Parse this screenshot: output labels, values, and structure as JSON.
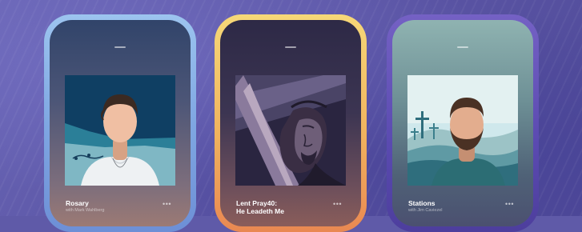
{
  "cards": [
    {
      "title": "Rosary",
      "subtitle": "with Mark Wahlberg",
      "more_label": "•••",
      "artwork": "man-portrait-artwork"
    },
    {
      "title_line1": "Lent Pray40:",
      "title_line2": "He Leadeth Me",
      "more_label": "•••",
      "artwork": "jesus-with-cross-artwork"
    },
    {
      "title": "Stations",
      "subtitle": "with Jim Caviezel",
      "more_label": "•••",
      "artwork": "bearded-man-crosses-artwork"
    }
  ],
  "colors": {
    "background": "#5f5aa8",
    "frame_blue": "#8fb6ea",
    "frame_gold": "#f0b35e",
    "frame_purple": "#5a4ab0"
  }
}
